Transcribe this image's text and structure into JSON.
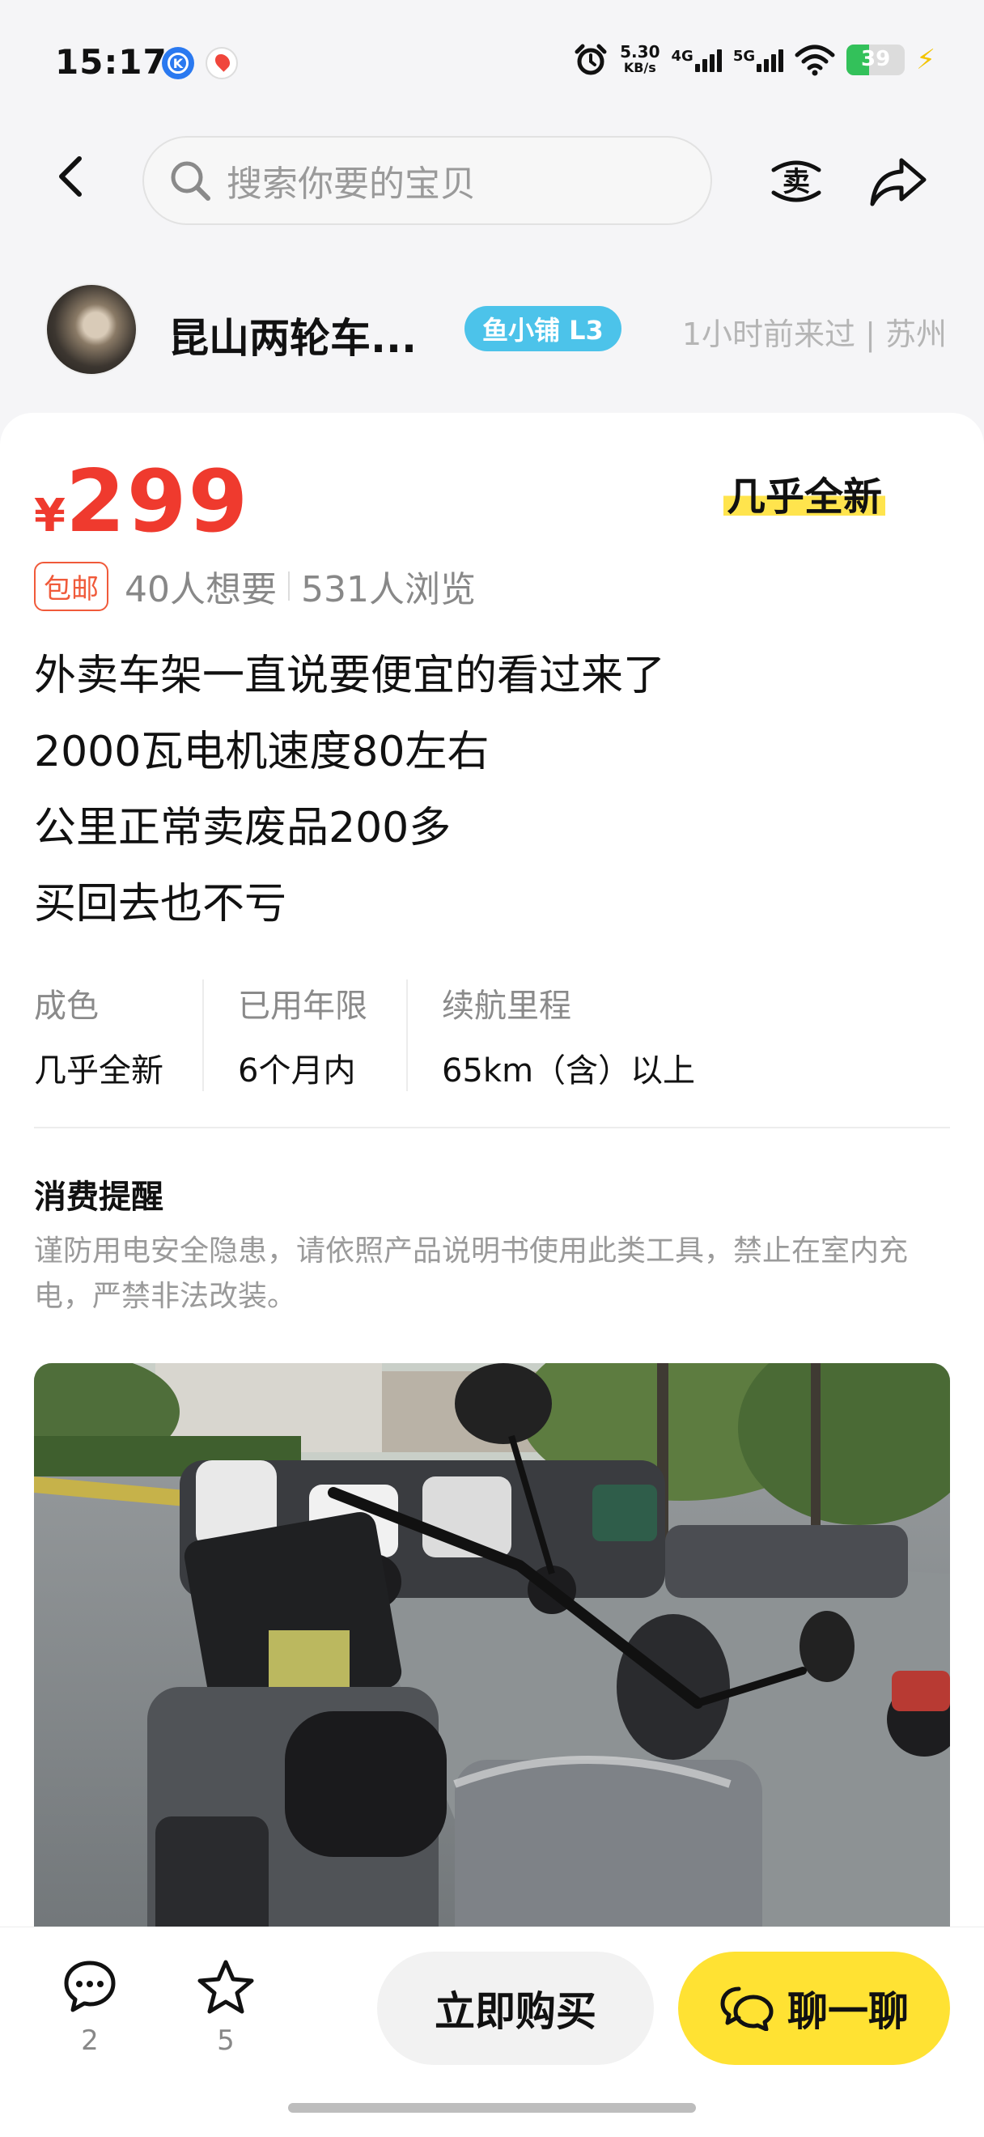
{
  "status_bar": {
    "time": "15:17",
    "speed_value": "5.30",
    "speed_unit": "KB/s",
    "net_1": "4G",
    "net_2": "5G",
    "battery": "39",
    "battery_level": 0.39
  },
  "nav": {
    "search_placeholder": "搜索你要的宝贝",
    "sell_icon": "sell-icon",
    "share_icon": "share-icon"
  },
  "seller": {
    "name": "昆山两轮车...",
    "badge": "鱼小铺 L3",
    "meta": "1小时前来过 | 苏州"
  },
  "listing": {
    "currency": "¥",
    "price": "299",
    "condition_tag": "几乎全新",
    "free_shipping": "包邮",
    "wants": "40人想要",
    "views": "531人浏览",
    "description": [
      "外卖车架一直说要便宜的看过来了",
      "2000瓦电机速度80左右",
      "公里正常卖废品200多",
      "买回去也不亏"
    ],
    "specs": [
      {
        "label": "成色",
        "value": "几乎全新"
      },
      {
        "label": "已用年限",
        "value": "6个月内"
      },
      {
        "label": "续航里程",
        "value": "65km（含）以上"
      }
    ]
  },
  "notice": {
    "title": "消费提醒",
    "text": "谨防用电安全隐患，请依照产品说明书使用此类工具，禁止在室内充电，严禁非法改装。"
  },
  "bottom_bar": {
    "comments_count": "2",
    "favorites_count": "5",
    "buy_label": "立即购买",
    "chat_label": "聊一聊"
  },
  "colors": {
    "price": "#ef3a2e",
    "accent_yellow": "#ffe233",
    "badge_blue": "#4cc3ea"
  }
}
